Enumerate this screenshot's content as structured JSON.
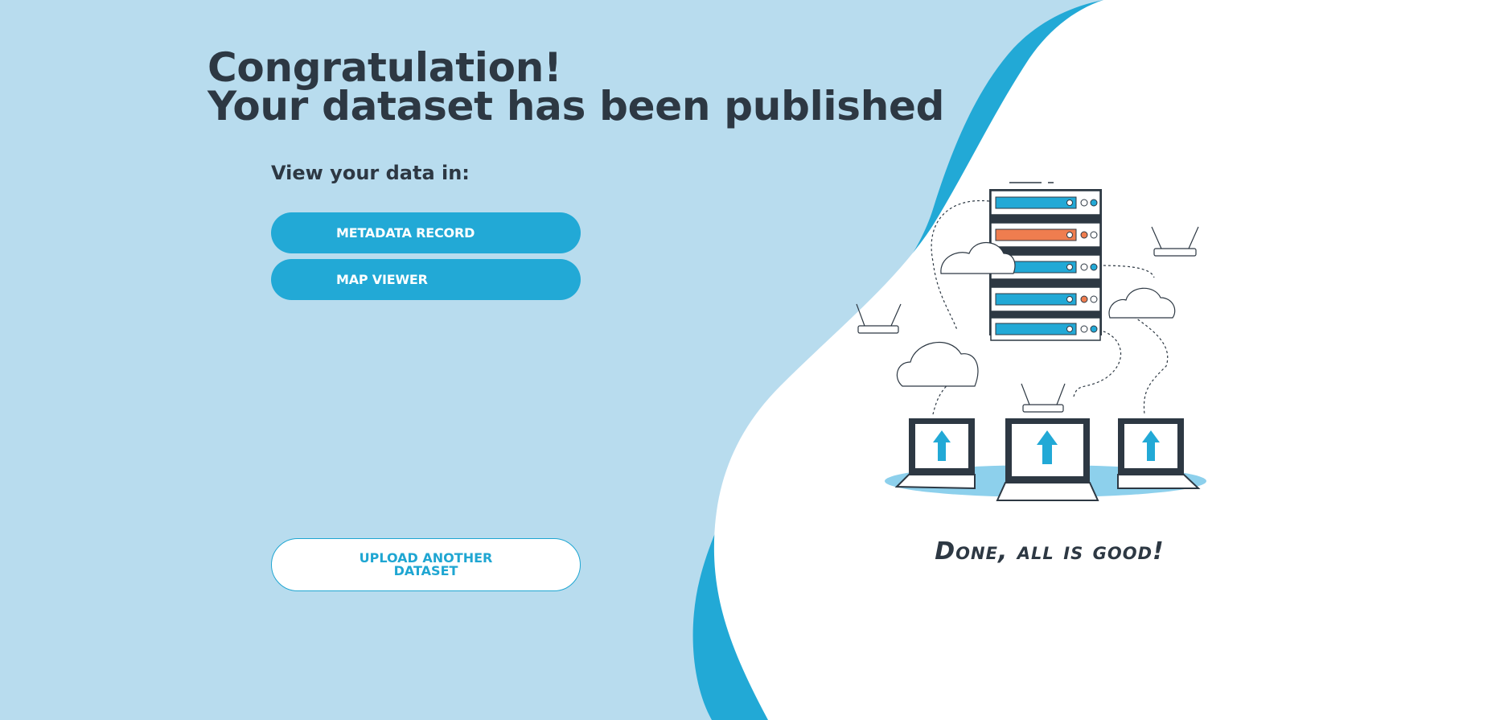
{
  "heading": {
    "line1": "Congratulation!",
    "line2": "Your dataset has been published"
  },
  "view_label": "View your data in:",
  "buttons": {
    "metadata_record": "METADATA RECORD",
    "map_viewer": "MAP VIEWER",
    "upload_line1": "UPLOAD ANOTHER",
    "upload_line2": "DATASET"
  },
  "illustration": {
    "caption": "Done, all is good!",
    "icons": [
      "server-rack-icon",
      "cloud-icon",
      "router-icon",
      "laptop-upload-icon"
    ]
  },
  "colors": {
    "background": "#b8dcee",
    "accent": "#22a9d6",
    "heading_text": "#2d3843",
    "server_alert": "#ef7d4f",
    "panel": "#ffffff"
  }
}
